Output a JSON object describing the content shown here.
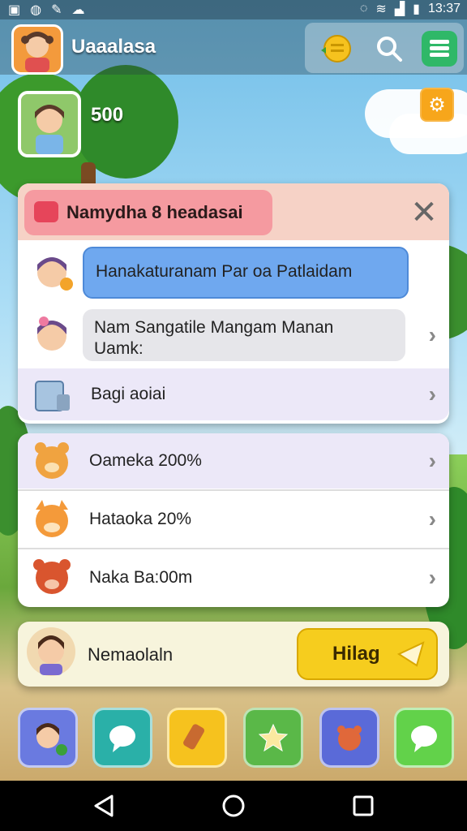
{
  "status_bar": {
    "time": "13:37"
  },
  "header": {
    "title": "Uaaalasa",
    "icons": [
      "coin-icon",
      "search-icon",
      "menu-list-icon"
    ]
  },
  "player": {
    "score": "500",
    "settings_icon": "gear-icon"
  },
  "panel": {
    "title": "Namydha 8 headasai",
    "items": [
      {
        "label": "Hanakaturanam Par oa Patlaidam"
      },
      {
        "label": "Nam Sangatile Mangam Manan Uamk:"
      },
      {
        "label": "Bagi aoiai"
      }
    ]
  },
  "rewards": {
    "items": [
      {
        "label": "Oameka 200%"
      },
      {
        "label": "Hataoka 20%"
      },
      {
        "label": "Naka Ba:00m"
      }
    ]
  },
  "bottom": {
    "name": "Nemaolaln",
    "action_label": "Hilag"
  },
  "dock": {
    "buttons": [
      "profile-icon",
      "chat-icon",
      "scroll-icon",
      "star-icon",
      "pet-icon",
      "message-icon"
    ]
  },
  "colors": {
    "accent_yellow": "#f6cd1e",
    "panel_header": "#f59aa0",
    "highlight_blue": "#6fa8ef"
  }
}
